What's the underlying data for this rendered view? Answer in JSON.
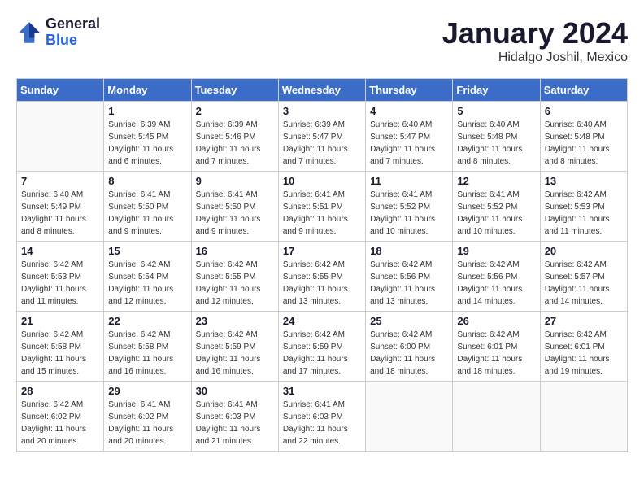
{
  "logo": {
    "general": "General",
    "blue": "Blue"
  },
  "title": "January 2024",
  "location": "Hidalgo Joshil, Mexico",
  "days_of_week": [
    "Sunday",
    "Monday",
    "Tuesday",
    "Wednesday",
    "Thursday",
    "Friday",
    "Saturday"
  ],
  "weeks": [
    [
      {
        "num": "",
        "sunrise": "",
        "sunset": "",
        "daylight": ""
      },
      {
        "num": "1",
        "sunrise": "Sunrise: 6:39 AM",
        "sunset": "Sunset: 5:45 PM",
        "daylight": "Daylight: 11 hours and 6 minutes."
      },
      {
        "num": "2",
        "sunrise": "Sunrise: 6:39 AM",
        "sunset": "Sunset: 5:46 PM",
        "daylight": "Daylight: 11 hours and 7 minutes."
      },
      {
        "num": "3",
        "sunrise": "Sunrise: 6:39 AM",
        "sunset": "Sunset: 5:47 PM",
        "daylight": "Daylight: 11 hours and 7 minutes."
      },
      {
        "num": "4",
        "sunrise": "Sunrise: 6:40 AM",
        "sunset": "Sunset: 5:47 PM",
        "daylight": "Daylight: 11 hours and 7 minutes."
      },
      {
        "num": "5",
        "sunrise": "Sunrise: 6:40 AM",
        "sunset": "Sunset: 5:48 PM",
        "daylight": "Daylight: 11 hours and 8 minutes."
      },
      {
        "num": "6",
        "sunrise": "Sunrise: 6:40 AM",
        "sunset": "Sunset: 5:48 PM",
        "daylight": "Daylight: 11 hours and 8 minutes."
      }
    ],
    [
      {
        "num": "7",
        "sunrise": "Sunrise: 6:40 AM",
        "sunset": "Sunset: 5:49 PM",
        "daylight": "Daylight: 11 hours and 8 minutes."
      },
      {
        "num": "8",
        "sunrise": "Sunrise: 6:41 AM",
        "sunset": "Sunset: 5:50 PM",
        "daylight": "Daylight: 11 hours and 9 minutes."
      },
      {
        "num": "9",
        "sunrise": "Sunrise: 6:41 AM",
        "sunset": "Sunset: 5:50 PM",
        "daylight": "Daylight: 11 hours and 9 minutes."
      },
      {
        "num": "10",
        "sunrise": "Sunrise: 6:41 AM",
        "sunset": "Sunset: 5:51 PM",
        "daylight": "Daylight: 11 hours and 9 minutes."
      },
      {
        "num": "11",
        "sunrise": "Sunrise: 6:41 AM",
        "sunset": "Sunset: 5:52 PM",
        "daylight": "Daylight: 11 hours and 10 minutes."
      },
      {
        "num": "12",
        "sunrise": "Sunrise: 6:41 AM",
        "sunset": "Sunset: 5:52 PM",
        "daylight": "Daylight: 11 hours and 10 minutes."
      },
      {
        "num": "13",
        "sunrise": "Sunrise: 6:42 AM",
        "sunset": "Sunset: 5:53 PM",
        "daylight": "Daylight: 11 hours and 11 minutes."
      }
    ],
    [
      {
        "num": "14",
        "sunrise": "Sunrise: 6:42 AM",
        "sunset": "Sunset: 5:53 PM",
        "daylight": "Daylight: 11 hours and 11 minutes."
      },
      {
        "num": "15",
        "sunrise": "Sunrise: 6:42 AM",
        "sunset": "Sunset: 5:54 PM",
        "daylight": "Daylight: 11 hours and 12 minutes."
      },
      {
        "num": "16",
        "sunrise": "Sunrise: 6:42 AM",
        "sunset": "Sunset: 5:55 PM",
        "daylight": "Daylight: 11 hours and 12 minutes."
      },
      {
        "num": "17",
        "sunrise": "Sunrise: 6:42 AM",
        "sunset": "Sunset: 5:55 PM",
        "daylight": "Daylight: 11 hours and 13 minutes."
      },
      {
        "num": "18",
        "sunrise": "Sunrise: 6:42 AM",
        "sunset": "Sunset: 5:56 PM",
        "daylight": "Daylight: 11 hours and 13 minutes."
      },
      {
        "num": "19",
        "sunrise": "Sunrise: 6:42 AM",
        "sunset": "Sunset: 5:56 PM",
        "daylight": "Daylight: 11 hours and 14 minutes."
      },
      {
        "num": "20",
        "sunrise": "Sunrise: 6:42 AM",
        "sunset": "Sunset: 5:57 PM",
        "daylight": "Daylight: 11 hours and 14 minutes."
      }
    ],
    [
      {
        "num": "21",
        "sunrise": "Sunrise: 6:42 AM",
        "sunset": "Sunset: 5:58 PM",
        "daylight": "Daylight: 11 hours and 15 minutes."
      },
      {
        "num": "22",
        "sunrise": "Sunrise: 6:42 AM",
        "sunset": "Sunset: 5:58 PM",
        "daylight": "Daylight: 11 hours and 16 minutes."
      },
      {
        "num": "23",
        "sunrise": "Sunrise: 6:42 AM",
        "sunset": "Sunset: 5:59 PM",
        "daylight": "Daylight: 11 hours and 16 minutes."
      },
      {
        "num": "24",
        "sunrise": "Sunrise: 6:42 AM",
        "sunset": "Sunset: 5:59 PM",
        "daylight": "Daylight: 11 hours and 17 minutes."
      },
      {
        "num": "25",
        "sunrise": "Sunrise: 6:42 AM",
        "sunset": "Sunset: 6:00 PM",
        "daylight": "Daylight: 11 hours and 18 minutes."
      },
      {
        "num": "26",
        "sunrise": "Sunrise: 6:42 AM",
        "sunset": "Sunset: 6:01 PM",
        "daylight": "Daylight: 11 hours and 18 minutes."
      },
      {
        "num": "27",
        "sunrise": "Sunrise: 6:42 AM",
        "sunset": "Sunset: 6:01 PM",
        "daylight": "Daylight: 11 hours and 19 minutes."
      }
    ],
    [
      {
        "num": "28",
        "sunrise": "Sunrise: 6:42 AM",
        "sunset": "Sunset: 6:02 PM",
        "daylight": "Daylight: 11 hours and 20 minutes."
      },
      {
        "num": "29",
        "sunrise": "Sunrise: 6:41 AM",
        "sunset": "Sunset: 6:02 PM",
        "daylight": "Daylight: 11 hours and 20 minutes."
      },
      {
        "num": "30",
        "sunrise": "Sunrise: 6:41 AM",
        "sunset": "Sunset: 6:03 PM",
        "daylight": "Daylight: 11 hours and 21 minutes."
      },
      {
        "num": "31",
        "sunrise": "Sunrise: 6:41 AM",
        "sunset": "Sunset: 6:03 PM",
        "daylight": "Daylight: 11 hours and 22 minutes."
      },
      {
        "num": "",
        "sunrise": "",
        "sunset": "",
        "daylight": ""
      },
      {
        "num": "",
        "sunrise": "",
        "sunset": "",
        "daylight": ""
      },
      {
        "num": "",
        "sunrise": "",
        "sunset": "",
        "daylight": ""
      }
    ]
  ]
}
